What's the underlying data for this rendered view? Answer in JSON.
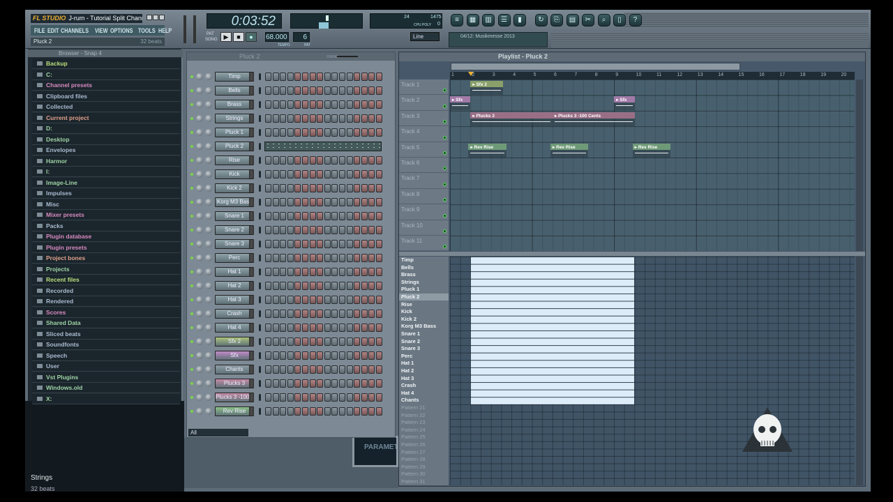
{
  "app": {
    "logo": "FL STUDIO",
    "title": "J-rum - Tutorial Split Channel...",
    "menu": [
      "FILE",
      "EDIT",
      "CHANNELS",
      "VIEW",
      "OPTIONS",
      "TOOLS",
      "HELP"
    ],
    "hint_name": "Pluck 2",
    "hint_value": "32 beats"
  },
  "transport": {
    "time": "0:03:52",
    "tempo": "68.000",
    "tempo_label": "TEMPO",
    "pattern": "6",
    "pattern_label": "PAT",
    "play": "▶",
    "stop": "■",
    "record": "●",
    "pat_mode": "PAT",
    "song_mode": "SONG",
    "snap": "Line",
    "cpu": "24",
    "poly": "1475",
    "cpu_label": "CPU",
    "poly_label": "POLY",
    "mem_label": "0"
  },
  "toolbar_icons": [
    "playlist-icon",
    "step-sequencer-icon",
    "piano-roll-icon",
    "browser-icon",
    "mixer-icon",
    "undo-icon",
    "save-icon",
    "render-icon",
    "cut-icon",
    "zoom-icon",
    "project-info-icon",
    "help-icon"
  ],
  "news": "04/12: Musikmesse 2013",
  "browser": {
    "title": "Browser - Snap 4",
    "items": [
      {
        "label": "Backup",
        "color": "#b9e07c"
      },
      {
        "label": "C:",
        "color": "#9ed4a6"
      },
      {
        "label": "Channel presets",
        "color": "#d78ac0"
      },
      {
        "label": "Clipboard files",
        "color": "#a9bcd0"
      },
      {
        "label": "Collected",
        "color": "#a9bcd0"
      },
      {
        "label": "Current project",
        "color": "#e0a08c"
      },
      {
        "label": "D:",
        "color": "#9ed4a6"
      },
      {
        "label": "Desktop",
        "color": "#9ed4a6"
      },
      {
        "label": "Envelopes",
        "color": "#a9bcd0"
      },
      {
        "label": "Harmor",
        "color": "#9ed4a6"
      },
      {
        "label": "I:",
        "color": "#9ed4a6"
      },
      {
        "label": "Image-Line",
        "color": "#9ed4a6"
      },
      {
        "label": "Impulses",
        "color": "#a9bcd0"
      },
      {
        "label": "Misc",
        "color": "#a9bcd0"
      },
      {
        "label": "Mixer presets",
        "color": "#d78ac0"
      },
      {
        "label": "Packs",
        "color": "#a9bcd0"
      },
      {
        "label": "Plugin database",
        "color": "#d78ac0"
      },
      {
        "label": "Plugin presets",
        "color": "#d78ac0"
      },
      {
        "label": "Project bones",
        "color": "#e0a08c"
      },
      {
        "label": "Projects",
        "color": "#9ed4a6"
      },
      {
        "label": "Recent files",
        "color": "#b9e07c"
      },
      {
        "label": "Recorded",
        "color": "#a9bcd0"
      },
      {
        "label": "Rendered",
        "color": "#a9bcd0"
      },
      {
        "label": "Scores",
        "color": "#d78ac0"
      },
      {
        "label": "Shared Data",
        "color": "#9ed4a6"
      },
      {
        "label": "Sliced beats",
        "color": "#a9bcd0"
      },
      {
        "label": "Soundfonts",
        "color": "#a9bcd0"
      },
      {
        "label": "Speech",
        "color": "#a9bcd0"
      },
      {
        "label": "User",
        "color": "#a9bcd0"
      },
      {
        "label": "Vst Plugins",
        "color": "#9ed4a6"
      },
      {
        "label": "Windows.old",
        "color": "#9ed4a6"
      },
      {
        "label": "X:",
        "color": "#9ed4a6"
      }
    ]
  },
  "hover_hint": {
    "name": "Strings",
    "value": "32 beats"
  },
  "rack": {
    "title": "Pluck 2",
    "swing_label": "SWING",
    "filter": "All",
    "channels": [
      {
        "name": "Timp",
        "color": "#8ea2a8"
      },
      {
        "name": "Bells",
        "color": "#8ea2a8"
      },
      {
        "name": "Brass",
        "color": "#8ea2a8"
      },
      {
        "name": "Strings",
        "color": "#8ea2a8"
      },
      {
        "name": "Pluck 1",
        "color": "#8ea2a8"
      },
      {
        "name": "Pluck 2",
        "color": "#8ea2a8",
        "piano_roll": true
      },
      {
        "name": "Rise",
        "color": "#8ea2a8"
      },
      {
        "name": "Kick",
        "color": "#8ea2a8"
      },
      {
        "name": "Kick 2",
        "color": "#8ea2a8"
      },
      {
        "name": "Korg M3 Bass",
        "color": "#8ea2a8"
      },
      {
        "name": "Snare 1",
        "color": "#8ea2a8"
      },
      {
        "name": "Snare 2",
        "color": "#8ea2a8"
      },
      {
        "name": "Snare 3",
        "color": "#8ea2a8"
      },
      {
        "name": "Perc",
        "color": "#8ea2a8"
      },
      {
        "name": "Hat 1",
        "color": "#8ea2a8"
      },
      {
        "name": "Hat 2",
        "color": "#8ea2a8"
      },
      {
        "name": "Hat 3",
        "color": "#8ea2a8"
      },
      {
        "name": "Crash",
        "color": "#8ea2a8"
      },
      {
        "name": "Hat 4",
        "color": "#8ea2a8"
      },
      {
        "name": "Sfx 2",
        "color": "#a9c27c"
      },
      {
        "name": "Sfx",
        "color": "#c08ac6"
      },
      {
        "name": "Chants",
        "color": "#8e9ca5"
      },
      {
        "name": "Plucks 3",
        "color": "#c58aa5"
      },
      {
        "name": "Plucks 3 -100 ...",
        "color": "#c58aa5"
      },
      {
        "name": "Rev Rise",
        "color": "#8cc08a"
      }
    ]
  },
  "playlist": {
    "title": "Playlist - Pluck 2",
    "bars": [
      "1",
      "2",
      "3",
      "4",
      "5",
      "6",
      "7",
      "8",
      "9",
      "10",
      "11",
      "12",
      "13",
      "14",
      "15",
      "16",
      "17",
      "18",
      "19",
      "20"
    ],
    "tracks": [
      "Track 1",
      "Track 2",
      "Track 3",
      "Track 4",
      "Track 5",
      "Track 6",
      "Track 7",
      "Track 8",
      "Track 9",
      "Track 10",
      "Track 11"
    ],
    "clips": [
      {
        "label": "Sfx 2",
        "track": 1,
        "start": 2,
        "end": 3.6,
        "color": "#8aa06a"
      },
      {
        "label": "Sfx",
        "track": 2,
        "start": 1,
        "end": 2,
        "color": "#a27aa8"
      },
      {
        "label": "Sfx",
        "track": 2,
        "start": 9,
        "end": 10,
        "color": "#a27aa8"
      },
      {
        "label": "Plucks 3",
        "track": 3,
        "start": 2,
        "end": 6,
        "color": "#9a6f86"
      },
      {
        "label": "Plucks 3 -100 Cents",
        "track": 3,
        "start": 6,
        "end": 10,
        "color": "#9a6f86"
      },
      {
        "label": "Rev Rise",
        "track": 5,
        "start": 1.9,
        "end": 3.75,
        "color": "#6f9a78"
      },
      {
        "label": "Rev Rise",
        "track": 5,
        "start": 5.9,
        "end": 7.75,
        "color": "#6f9a78"
      },
      {
        "label": "Rev Rise",
        "track": 5,
        "start": 9.9,
        "end": 11.75,
        "color": "#6f9a78"
      }
    ],
    "patterns": [
      "Timp",
      "Bells",
      "Brass",
      "Strings",
      "Pluck 1",
      "Pluck 2",
      "Rise",
      "Kick",
      "Kick 2",
      "Korg M3 Bass",
      "Snare 1",
      "Snare 2",
      "Snare 3",
      "Perc",
      "Hat 1",
      "Hat 2",
      "Hat 3",
      "Crash",
      "Hat 4",
      "Chants",
      "Pattern 21",
      "Pattern 22",
      "Pattern 23",
      "Pattern 24",
      "Pattern 25",
      "Pattern 26",
      "Pattern 27",
      "Pattern 28",
      "Pattern 29",
      "Pattern 30",
      "Pattern 31"
    ],
    "selected_pattern": "Pluck 2"
  },
  "background_panel": "PARAMET"
}
